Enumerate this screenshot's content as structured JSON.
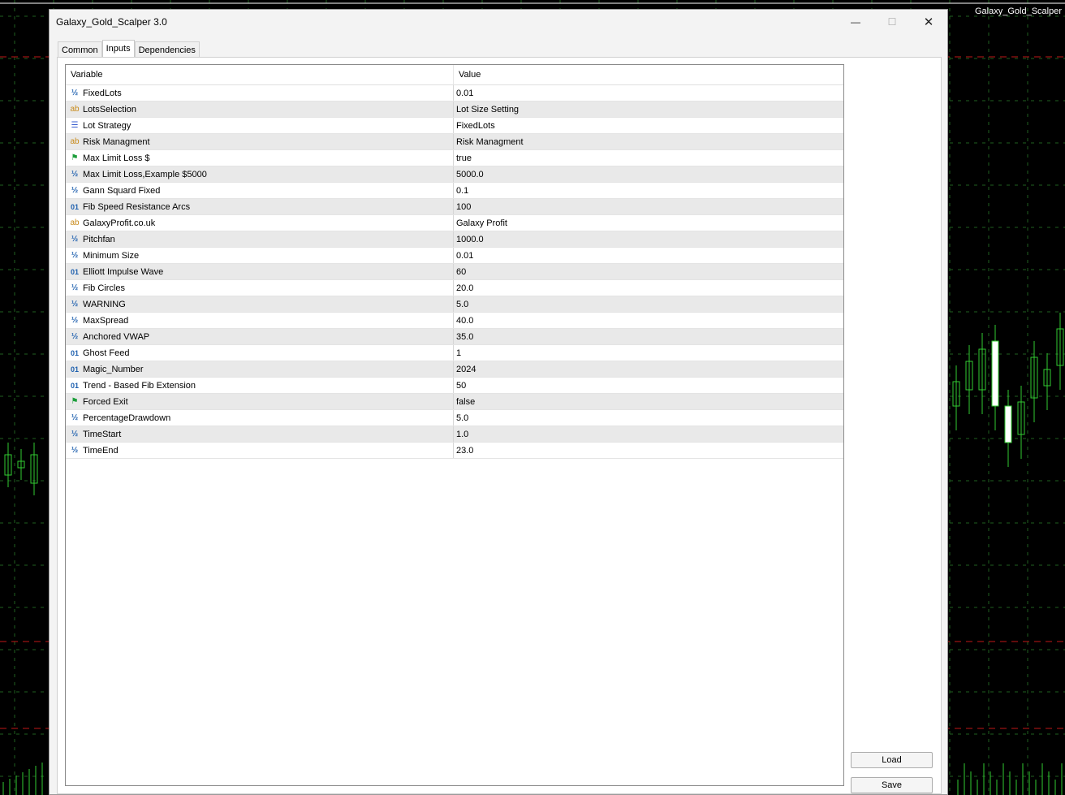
{
  "chart_title": "Galaxy_Gold_Scalper",
  "window": {
    "title": "Galaxy_Gold_Scalper 3.0",
    "minimize_glyph": "—",
    "maximize_glyph": "☐",
    "close_glyph": "✕"
  },
  "tabs": [
    {
      "label": "Common"
    },
    {
      "label": "Inputs"
    },
    {
      "label": "Dependencies"
    }
  ],
  "active_tab": "Inputs",
  "grid": {
    "header_variable": "Variable",
    "header_value": "Value",
    "rows": [
      {
        "icon": "double",
        "variable": "FixedLots",
        "value": "0.01"
      },
      {
        "icon": "string",
        "variable": "LotsSelection",
        "value": "Lot Size Setting"
      },
      {
        "icon": "enum",
        "variable": "Lot Strategy",
        "value": "FixedLots"
      },
      {
        "icon": "string",
        "variable": "Risk Managment",
        "value": "Risk Managment"
      },
      {
        "icon": "bool",
        "variable": "Max Limit Loss $",
        "value": "true"
      },
      {
        "icon": "double",
        "variable": "Max Limit Loss,Example $5000",
        "value": "5000.0"
      },
      {
        "icon": "double",
        "variable": "Gann Squard Fixed",
        "value": "0.1"
      },
      {
        "icon": "int",
        "variable": "Fib Speed Resistance Arcs",
        "value": "100"
      },
      {
        "icon": "string",
        "variable": "GalaxyProfit.co.uk",
        "value": "Galaxy Profit"
      },
      {
        "icon": "double",
        "variable": "Pitchfan",
        "value": "1000.0"
      },
      {
        "icon": "double",
        "variable": "Minimum Size",
        "value": "0.01"
      },
      {
        "icon": "int",
        "variable": "Elliott Impulse Wave",
        "value": "60"
      },
      {
        "icon": "double",
        "variable": "Fib Circles",
        "value": "20.0"
      },
      {
        "icon": "double",
        "variable": "WARNING",
        "value": "5.0"
      },
      {
        "icon": "double",
        "variable": "MaxSpread",
        "value": "40.0"
      },
      {
        "icon": "double",
        "variable": "Anchored VWAP",
        "value": "35.0"
      },
      {
        "icon": "int",
        "variable": "Ghost Feed",
        "value": "1"
      },
      {
        "icon": "int",
        "variable": "Magic_Number",
        "value": "2024"
      },
      {
        "icon": "int",
        "variable": "Trend - Based Fib Extension",
        "value": "50"
      },
      {
        "icon": "bool",
        "variable": "Forced Exit",
        "value": "false"
      },
      {
        "icon": "double",
        "variable": "PercentageDrawdown",
        "value": "5.0"
      },
      {
        "icon": "double",
        "variable": "TimeStart",
        "value": "1.0"
      },
      {
        "icon": "double",
        "variable": "TimeEnd",
        "value": "23.0"
      }
    ]
  },
  "buttons": {
    "load": "Load",
    "save": "Save"
  },
  "icon_glyphs": {
    "double": "½",
    "string": "ab",
    "int": "01",
    "bool": "⚑",
    "enum": "☰"
  },
  "colors": {
    "chart_background": "#000000",
    "grid_dash": "#1f5f1f",
    "candle_green": "#32cd32",
    "level_red": "#c01818"
  }
}
